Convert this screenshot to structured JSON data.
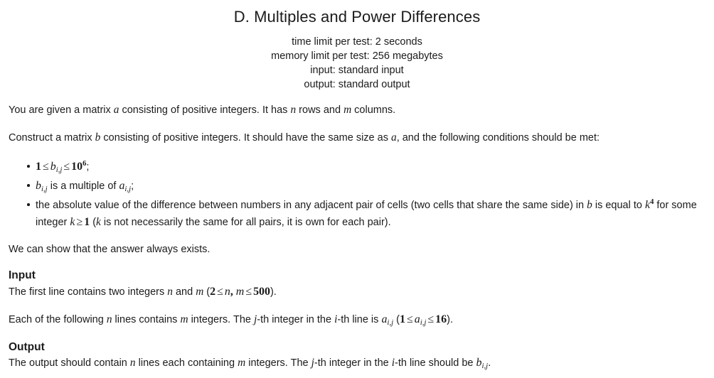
{
  "header": {
    "title": "D. Multiples and Power Differences",
    "limits": [
      "time limit per test: 2 seconds",
      "memory limit per test: 256 megabytes",
      "input: standard input",
      "output: standard output"
    ]
  },
  "statement": {
    "p1": {
      "t1": "You are given a matrix ",
      "m_a": "a",
      "t2": " consisting of positive integers. It has ",
      "m_n": "n",
      "t3": " rows and ",
      "m_m": "m",
      "t4": " columns."
    },
    "p2": {
      "t1": "Construct a matrix ",
      "m_b": "b",
      "t2": " consisting of positive integers. It should have the same size as ",
      "m_a": "a",
      "t3": ", and the following conditions should be met:"
    },
    "conditions": {
      "c1": {
        "m_one": "1",
        "m_le1": "≤",
        "m_b": "b",
        "m_b_sub": "i,j",
        "m_le2": "≤",
        "m_ten": "10",
        "m_exp": "6",
        "tail": ";"
      },
      "c2": {
        "m_b": "b",
        "m_b_sub": "i,j",
        "t1": " is a multiple of ",
        "m_a": "a",
        "m_a_sub": "i,j",
        "tail": ";"
      },
      "c3": {
        "t1": "the absolute value of the difference between numbers in any adjacent pair of cells (two cells that share the same side) in ",
        "m_b": "b",
        "t2": " is equal to ",
        "m_k": "k",
        "m_k_exp": "4",
        "t3": " for some integer ",
        "m_k2": "k",
        "m_ge": "≥",
        "m_one": "1",
        "t4": " (",
        "m_k3": "k",
        "t5": " is not necessarily the same for all pairs, it is own for each pair)."
      }
    },
    "p3": "We can show that the answer always exists."
  },
  "input_section": {
    "heading": "Input",
    "p1": {
      "t1": "The first line contains two integers ",
      "m_n": "n",
      "t2": " and ",
      "m_m": "m",
      "t3": " (",
      "m_two": "2",
      "m_le1": "≤",
      "m_n2": "n",
      "m_comma": ",",
      "m_m2": "m",
      "m_le2": "≤",
      "m_500": "500",
      "t4": ")."
    },
    "p2": {
      "t1": "Each of the following ",
      "m_n": "n",
      "t2": " lines contains ",
      "m_m": "m",
      "t3": " integers. The ",
      "m_j": "j",
      "t4": "-th integer in the ",
      "m_i": "i",
      "t5": "-th line is ",
      "m_a": "a",
      "m_a_sub": "i,j",
      "t6": " (",
      "m_one": "1",
      "m_le1": "≤",
      "m_a2": "a",
      "m_a2_sub": "i,j",
      "m_le2": "≤",
      "m_16": "16",
      "t7": ")."
    }
  },
  "output_section": {
    "heading": "Output",
    "p1": {
      "t1": "The output should contain ",
      "m_n": "n",
      "t2": " lines each containing ",
      "m_m": "m",
      "t3": " integers. The ",
      "m_j": "j",
      "t4": "-th integer in the ",
      "m_i": "i",
      "t5": "-th line should be ",
      "m_b": "b",
      "m_b_sub": "i,j",
      "t6": "."
    }
  },
  "colors": {
    "text": "#1b1b1b",
    "background": "#ffffff"
  }
}
